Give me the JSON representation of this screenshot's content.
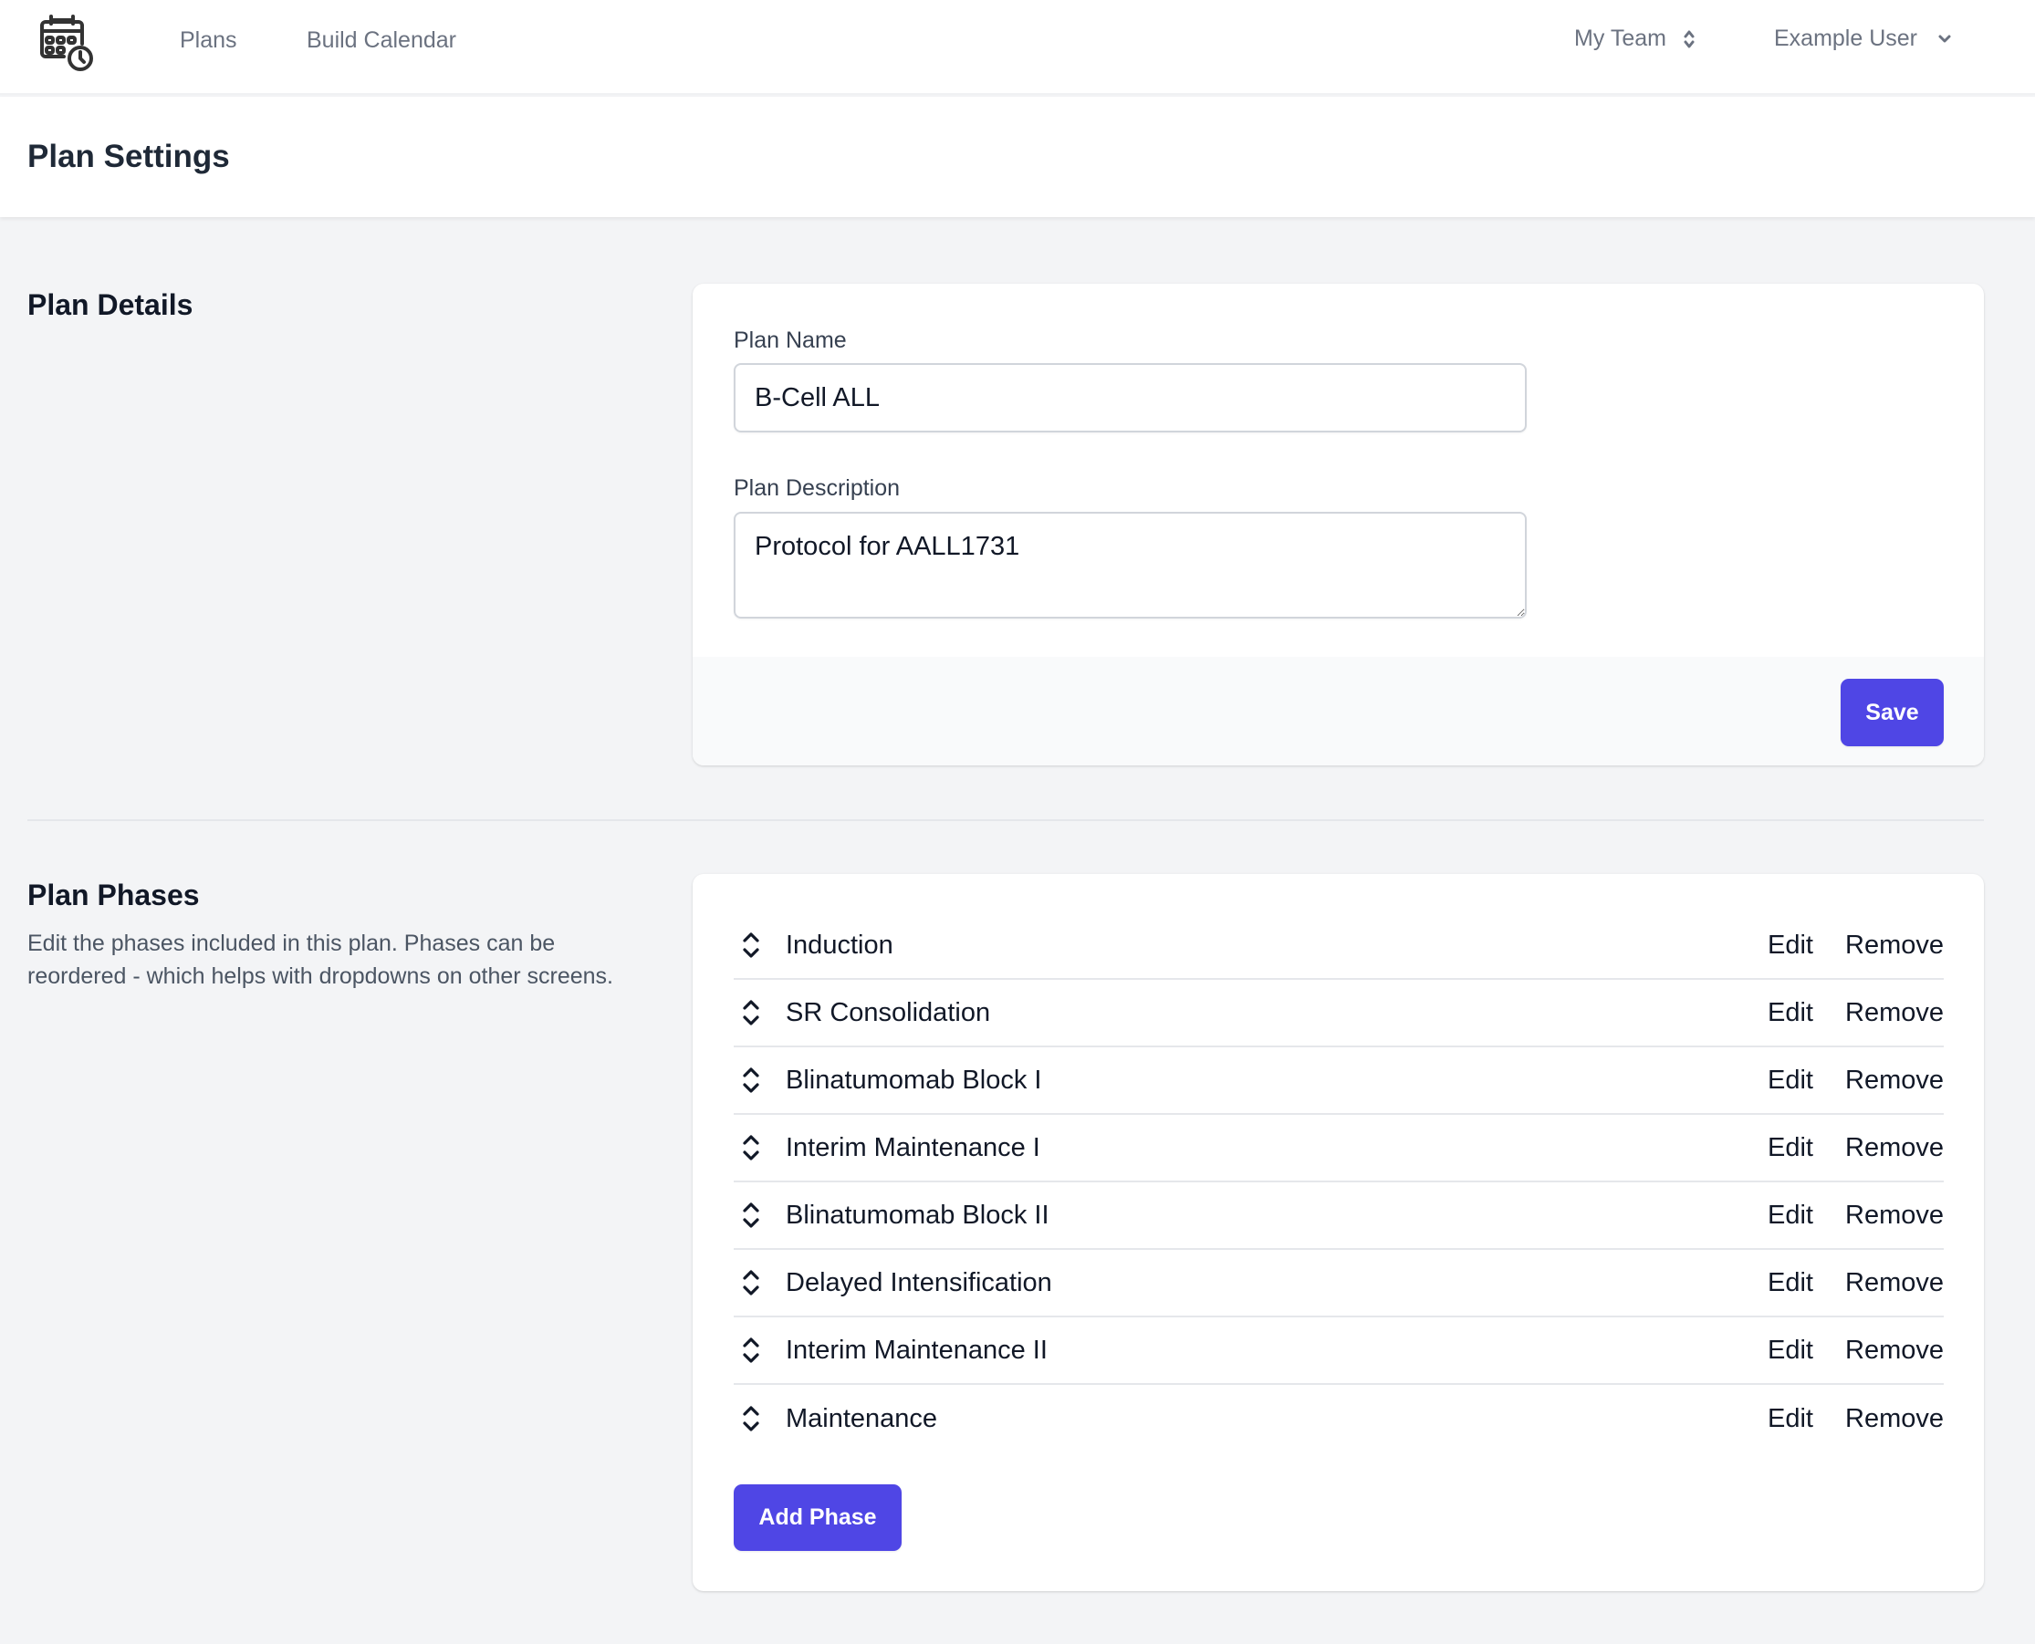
{
  "nav": {
    "logo": "calendar-clock-icon",
    "links": [
      {
        "label": "Plans"
      },
      {
        "label": "Build Calendar"
      }
    ],
    "team_selector": {
      "label": "My Team",
      "icon": "chevron-up-down-icon"
    },
    "user_menu": {
      "label": "Example User",
      "icon": "chevron-down-icon"
    }
  },
  "page": {
    "title": "Plan Settings"
  },
  "plan_details": {
    "section_title": "Plan Details",
    "name_label": "Plan Name",
    "name_value": "B-Cell ALL",
    "description_label": "Plan Description",
    "description_value": "Protocol for AALL1731",
    "save_label": "Save"
  },
  "plan_phases": {
    "section_title": "Plan Phases",
    "description": "Edit the phases included in this plan. Phases can be reordered - which helps with dropdowns on other screens.",
    "edit_label": "Edit",
    "remove_label": "Remove",
    "add_label": "Add Phase",
    "phases": [
      {
        "name": "Induction"
      },
      {
        "name": "SR Consolidation"
      },
      {
        "name": "Blinatumomab Block I"
      },
      {
        "name": "Interim Maintenance I"
      },
      {
        "name": "Blinatumomab Block II"
      },
      {
        "name": "Delayed Intensification"
      },
      {
        "name": "Interim Maintenance II"
      },
      {
        "name": "Maintenance"
      }
    ]
  },
  "colors": {
    "primary": "#4f46e5",
    "background": "#f3f4f6",
    "muted_text": "#6b7280"
  }
}
